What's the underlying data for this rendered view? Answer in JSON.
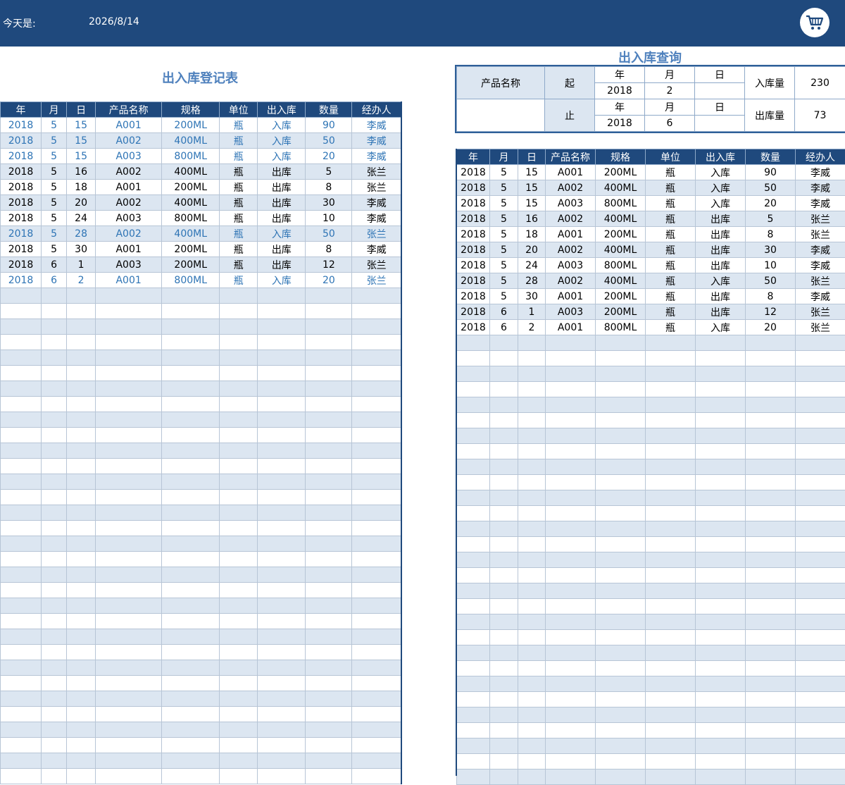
{
  "header": {
    "today_label": "今天是:",
    "today_date": "2026/8/14",
    "cart_icon": "shopping-cart-icon"
  },
  "register": {
    "title": "出入库登记表",
    "columns": [
      "年",
      "月",
      "日",
      "产品名称",
      "规格",
      "单位",
      "出入库",
      "数量",
      "经办人"
    ],
    "rows": [
      [
        "2018",
        "5",
        "15",
        "A001",
        "200ML",
        "瓶",
        "入库",
        "90",
        "李威"
      ],
      [
        "2018",
        "5",
        "15",
        "A002",
        "400ML",
        "瓶",
        "入库",
        "50",
        "李威"
      ],
      [
        "2018",
        "5",
        "15",
        "A003",
        "800ML",
        "瓶",
        "入库",
        "20",
        "李威"
      ],
      [
        "2018",
        "5",
        "16",
        "A002",
        "400ML",
        "瓶",
        "出库",
        "5",
        "张兰"
      ],
      [
        "2018",
        "5",
        "18",
        "A001",
        "200ML",
        "瓶",
        "出库",
        "8",
        "张兰"
      ],
      [
        "2018",
        "5",
        "20",
        "A002",
        "400ML",
        "瓶",
        "出库",
        "30",
        "李威"
      ],
      [
        "2018",
        "5",
        "24",
        "A003",
        "800ML",
        "瓶",
        "出库",
        "10",
        "李威"
      ],
      [
        "2018",
        "5",
        "28",
        "A002",
        "400ML",
        "瓶",
        "入库",
        "50",
        "张兰"
      ],
      [
        "2018",
        "5",
        "30",
        "A001",
        "200ML",
        "瓶",
        "出库",
        "8",
        "李威"
      ],
      [
        "2018",
        "6",
        "1",
        "A003",
        "200ML",
        "瓶",
        "出库",
        "12",
        "张兰"
      ],
      [
        "2018",
        "6",
        "2",
        "A001",
        "800ML",
        "瓶",
        "入库",
        "20",
        "张兰"
      ]
    ],
    "in_label": "入库",
    "empty_rows": 32
  },
  "query": {
    "title": "出入库查询",
    "product_label": "产品名称",
    "product_value": "",
    "start_label": "起",
    "end_label": "止",
    "year_label": "年",
    "month_label": "月",
    "day_label": "日",
    "start_year": "2018",
    "start_month": "2",
    "start_day": "",
    "end_year": "2018",
    "end_month": "6",
    "end_day": "",
    "in_qty_label": "入库量",
    "in_qty": "230",
    "out_qty_label": "出库量",
    "out_qty": "73"
  },
  "results": {
    "columns": [
      "年",
      "月",
      "日",
      "产品名称",
      "规格",
      "单位",
      "出入库",
      "数量",
      "经办人"
    ],
    "rows": [
      [
        "2018",
        "5",
        "15",
        "A001",
        "200ML",
        "瓶",
        "入库",
        "90",
        "李威"
      ],
      [
        "2018",
        "5",
        "15",
        "A002",
        "400ML",
        "瓶",
        "入库",
        "50",
        "李威"
      ],
      [
        "2018",
        "5",
        "15",
        "A003",
        "800ML",
        "瓶",
        "入库",
        "20",
        "李威"
      ],
      [
        "2018",
        "5",
        "16",
        "A002",
        "400ML",
        "瓶",
        "出库",
        "5",
        "张兰"
      ],
      [
        "2018",
        "5",
        "18",
        "A001",
        "200ML",
        "瓶",
        "出库",
        "8",
        "张兰"
      ],
      [
        "2018",
        "5",
        "20",
        "A002",
        "400ML",
        "瓶",
        "出库",
        "30",
        "李威"
      ],
      [
        "2018",
        "5",
        "24",
        "A003",
        "800ML",
        "瓶",
        "出库",
        "10",
        "李威"
      ],
      [
        "2018",
        "5",
        "28",
        "A002",
        "400ML",
        "瓶",
        "入库",
        "50",
        "张兰"
      ],
      [
        "2018",
        "5",
        "30",
        "A001",
        "200ML",
        "瓶",
        "出库",
        "8",
        "李威"
      ],
      [
        "2018",
        "6",
        "1",
        "A003",
        "200ML",
        "瓶",
        "出库",
        "12",
        "张兰"
      ],
      [
        "2018",
        "6",
        "2",
        "A001",
        "800ML",
        "瓶",
        "入库",
        "20",
        "张兰"
      ]
    ],
    "empty_rows": 29
  },
  "colors": {
    "header_bg": "#1f497d",
    "stripe": "#dce6f1",
    "in_text": "#2e74b5",
    "title": "#4f81bd"
  }
}
